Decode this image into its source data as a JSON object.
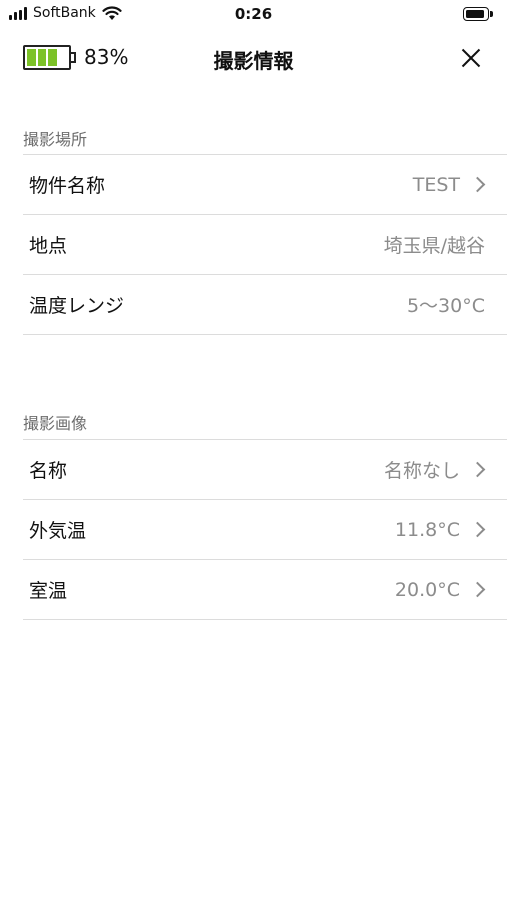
{
  "status_bar": {
    "carrier": "SoftBank",
    "time": "0:26",
    "battery_level": 0.9
  },
  "nav": {
    "device_battery_percent": "83%",
    "device_battery_level": 0.83,
    "title": "撮影情報",
    "close_icon": "close-x-icon"
  },
  "colors": {
    "device_battery_fill": "#7cc228",
    "value_text": "#8c8c8c",
    "section_header": "#6e6e6e",
    "divider": "#dcdcdc"
  },
  "sections": [
    {
      "header": "撮影場所",
      "rows": [
        {
          "label": "物件名称",
          "value": "TEST",
          "has_chevron": true
        },
        {
          "label": "地点",
          "value": "埼玉県/越谷",
          "has_chevron": false
        },
        {
          "label": "温度レンジ",
          "value": "5～30°C",
          "has_chevron": false
        }
      ]
    },
    {
      "header": "撮影画像",
      "rows": [
        {
          "label": "名称",
          "value": "名称なし",
          "has_chevron": true
        },
        {
          "label": "外気温",
          "value": "11.8°C",
          "has_chevron": true
        },
        {
          "label": "室温",
          "value": "20.0°C",
          "has_chevron": true
        }
      ]
    }
  ]
}
